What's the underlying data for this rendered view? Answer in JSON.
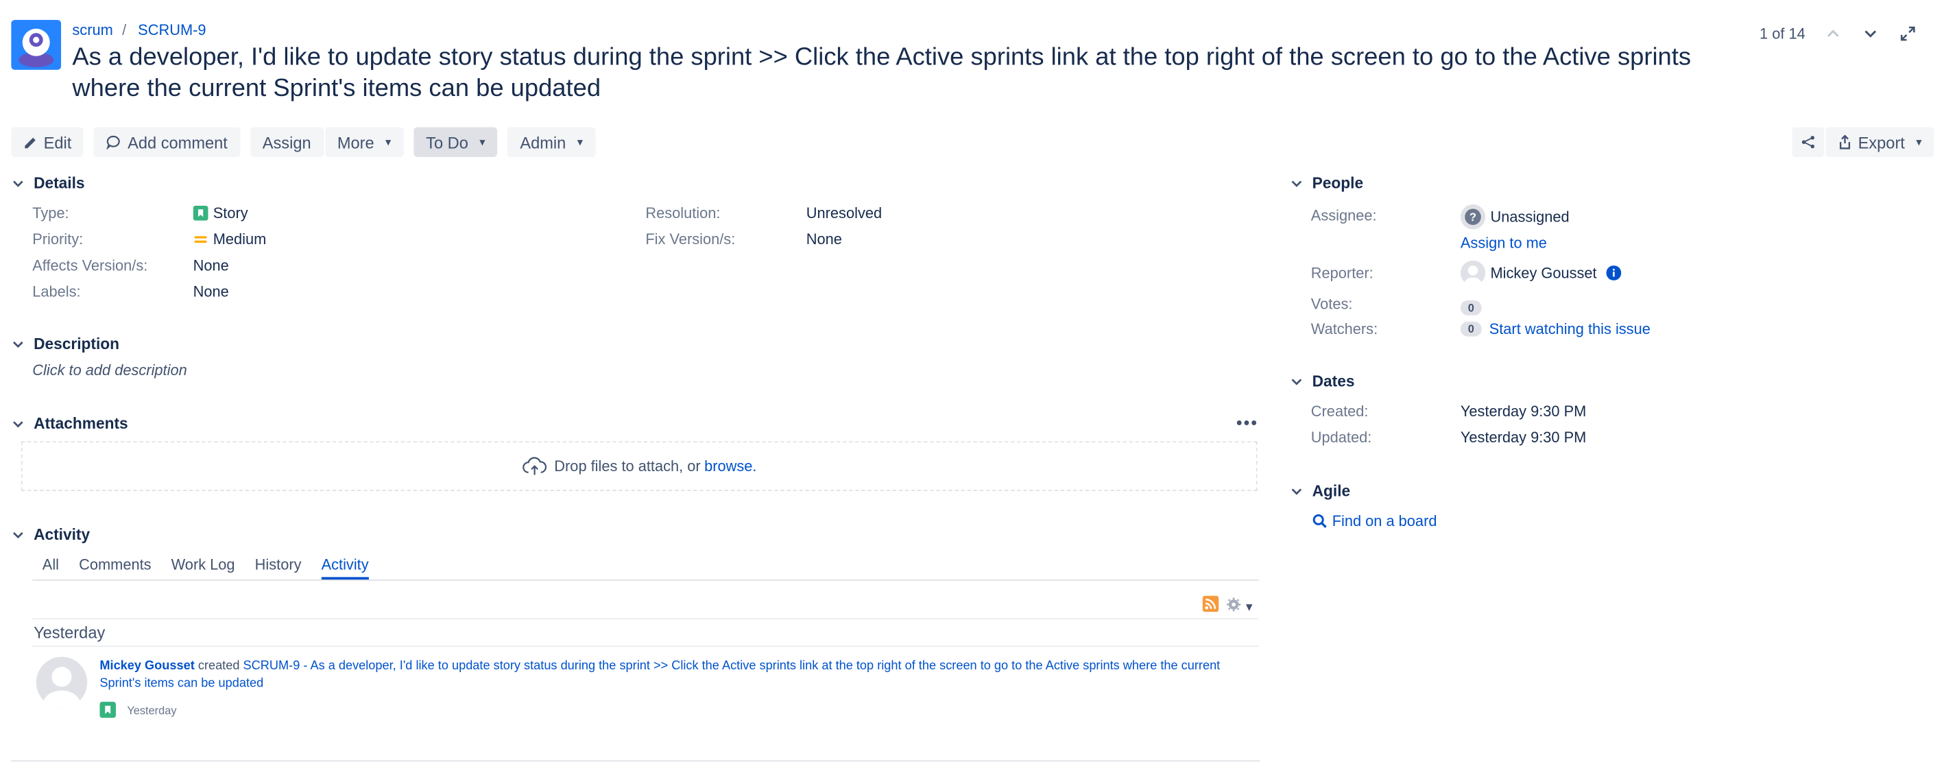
{
  "breadcrumbs": {
    "project": "scrum",
    "issue_key": "SCRUM-9"
  },
  "issue": {
    "summary": "As a developer, I'd like to update story status during the sprint >> Click the Active sprints link at the top right of the screen to go to the Active sprints where the current Sprint's items can be updated"
  },
  "pager": {
    "text": "1 of 14"
  },
  "toolbar": {
    "edit": "Edit",
    "add_comment": "Add comment",
    "assign": "Assign",
    "more": "More",
    "status": "To Do",
    "admin": "Admin",
    "export": "Export"
  },
  "details": {
    "title": "Details",
    "type_label": "Type:",
    "type_value": "Story",
    "priority_label": "Priority:",
    "priority_value": "Medium",
    "affects_label": "Affects Version/s:",
    "affects_value": "None",
    "labels_label": "Labels:",
    "labels_value": "None",
    "resolution_label": "Resolution:",
    "resolution_value": "Unresolved",
    "fix_label": "Fix Version/s:",
    "fix_value": "None"
  },
  "description": {
    "title": "Description",
    "placeholder": "Click to add description"
  },
  "attachments": {
    "title": "Attachments",
    "drop_text": "Drop files to attach, or ",
    "browse": "browse."
  },
  "activity": {
    "title": "Activity",
    "tabs": [
      "All",
      "Comments",
      "Work Log",
      "History",
      "Activity"
    ],
    "group": "Yesterday",
    "entry": {
      "user": "Mickey Gousset",
      "verb": " created ",
      "link": "SCRUM-9 - As a developer, I'd like to update story status during the sprint >> Click the Active sprints link at the top right of the screen to go to the Active sprints where the current Sprint's items can be updated",
      "time": "Yesterday"
    }
  },
  "people": {
    "title": "People",
    "assignee_label": "Assignee:",
    "assignee_value": "Unassigned",
    "assign_to_me": "Assign to me",
    "reporter_label": "Reporter:",
    "reporter_value": "Mickey Gousset",
    "votes_label": "Votes:",
    "votes_count": "0",
    "watchers_label": "Watchers:",
    "watchers_count": "0",
    "start_watching": "Start watching this issue"
  },
  "dates": {
    "title": "Dates",
    "created_label": "Created:",
    "created_value": "Yesterday 9:30 PM",
    "updated_label": "Updated:",
    "updated_value": "Yesterday 9:30 PM"
  },
  "agile": {
    "title": "Agile",
    "find_on_board": "Find on a board"
  },
  "colors": {
    "link": "#0052cc",
    "story_green": "#36b37e",
    "priority_orange": "#ffab00",
    "rss_orange": "#f79a3e"
  }
}
